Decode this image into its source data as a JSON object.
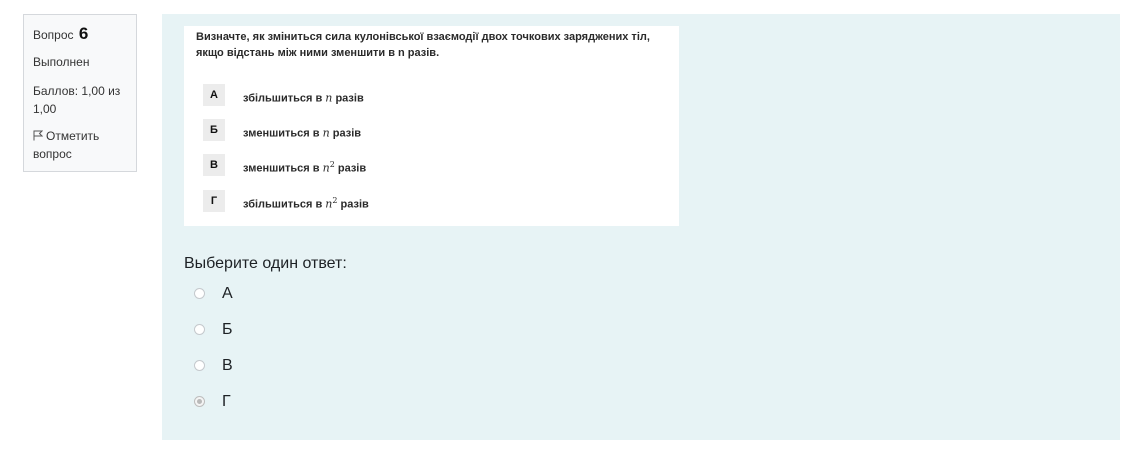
{
  "info": {
    "question_label": "Вопрос",
    "question_number": "6",
    "state": "Выполнен",
    "grade": "Баллов: 1,00 из 1,00",
    "flag_label": "Отметить вопрос"
  },
  "question": {
    "text": "Визначте, як зміниться сила кулонівської взаємодії двох точкових заряджених тіл, якщо відстань між ними зменшити в n разів.",
    "options": [
      {
        "letter": "А",
        "prefix": "збільшиться в",
        "var": "n",
        "power": "",
        "suffix": "разів"
      },
      {
        "letter": "Б",
        "prefix": "зменшиться в",
        "var": "n",
        "power": "",
        "suffix": "разів"
      },
      {
        "letter": "В",
        "prefix": "зменшиться в",
        "var": "n",
        "power": "2",
        "suffix": "разів"
      },
      {
        "letter": "Г",
        "prefix": "збільшиться в",
        "var": "n",
        "power": "2",
        "suffix": "разів"
      }
    ]
  },
  "prompt": "Выберите один ответ:",
  "answers": [
    {
      "label": "А",
      "checked": false
    },
    {
      "label": "Б",
      "checked": false
    },
    {
      "label": "В",
      "checked": false
    },
    {
      "label": "Г",
      "checked": true
    }
  ],
  "colors": {
    "content_bg": "#e7f3f5",
    "info_bg": "#f8f9fa"
  },
  "icons": {
    "flag": "flag-outline-icon"
  }
}
